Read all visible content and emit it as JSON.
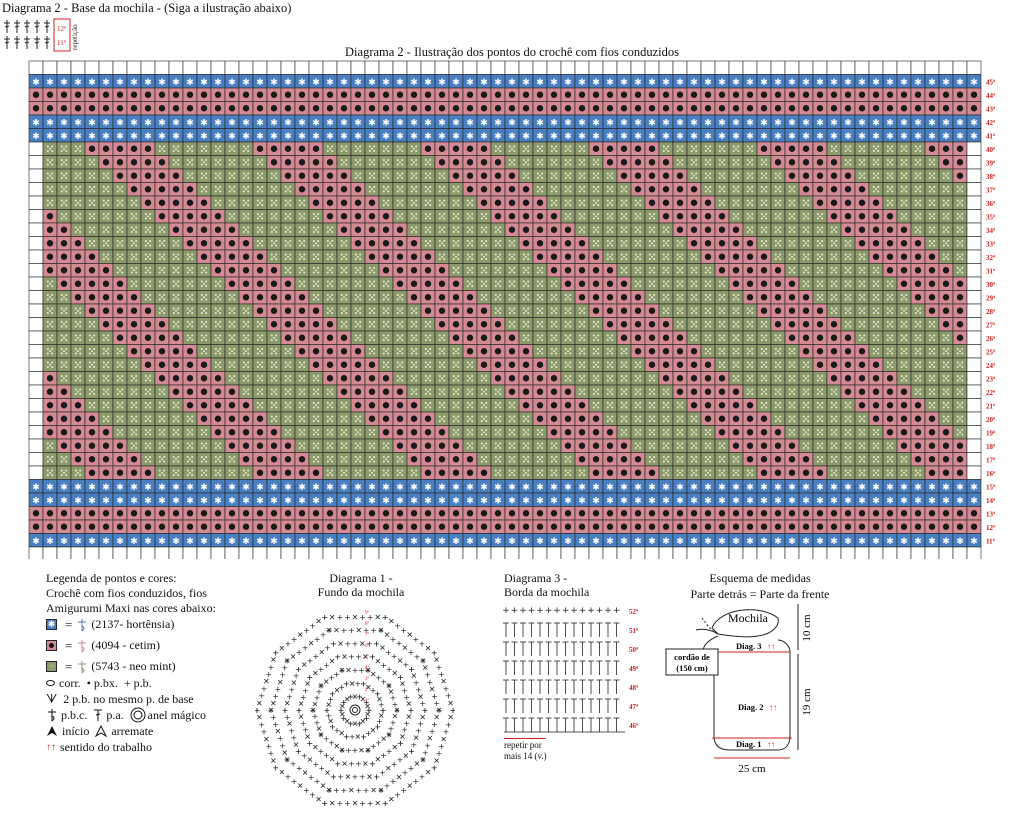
{
  "title_top": "Diagrama 2 - Base da mochila -  (Siga a ilustração abaixo)",
  "repeat_legend": {
    "row_a": "12ª",
    "row_b": "11ª",
    "label": "repetição"
  },
  "grid_title": "Diagrama 2 - Ilustração dos pontos do crochê com fios conduzidos",
  "grid": {
    "columns": 68,
    "first_row": 11,
    "last_row": 45,
    "row_suffix": "ª",
    "blue_rows": [
      11,
      14,
      15,
      41,
      42,
      45
    ],
    "pink_rows": [
      12,
      13,
      43,
      44
    ],
    "pattern_rows_from": 16,
    "pattern_rows_to": 40,
    "colors": {
      "blue": "#4a7fc1",
      "pink": "#d38a92",
      "mint": "#8c9a6c",
      "dot": "#1a1a1a",
      "label": "#d21f1f"
    }
  },
  "legend": {
    "heading_1": "Legenda de pontos e cores:",
    "heading_2": "Crochê com fios conduzidos, fios",
    "heading_3": "Amigurumi Maxi nas cores abaixo:",
    "colors": [
      {
        "swatch": "blue",
        "text": "(2137- hortênsia)"
      },
      {
        "swatch": "pink",
        "text": "(4094 - cetim)"
      },
      {
        "swatch": "mint",
        "text": "(5743 - neo mint)"
      }
    ],
    "equals": "=",
    "sym_1": "corr.",
    "sym_2": "p.bx.",
    "sym_3": "p.b.",
    "sym_4": "2 p.b. no mesmo p. de base",
    "sym_5": "p.b.c.",
    "sym_6": "p.a.",
    "sym_7": "anel mágico",
    "sym_8": "início",
    "sym_9": "arremate",
    "sym_10": "sentido do trabalho"
  },
  "diagram1": {
    "line1": "Diagrama 1 -",
    "line2": "Fundo da mochila"
  },
  "diagram3": {
    "line1": "Diagrama 3 -",
    "line2": "Borda da mochila",
    "rows": [
      "52ª",
      "51ª",
      "50ª",
      "49ª",
      "48ª",
      "47ª",
      "46ª"
    ],
    "repeat_1": "repetir por",
    "repeat_2": "mais 14 (v.)"
  },
  "measures": {
    "title": "Esquema de medidas",
    "subtitle": "Parte detrás = Parte da frente",
    "bag_label": "Mochila",
    "cord_1": "cordão de",
    "cord_2": "(150 cm)",
    "diag3": "Diag. 3",
    "diag2": "Diag. 2",
    "diag1": "Diag. 1",
    "dim_top": "10 cm",
    "dim_side": "19 cm",
    "dim_bottom": "25 cm"
  }
}
